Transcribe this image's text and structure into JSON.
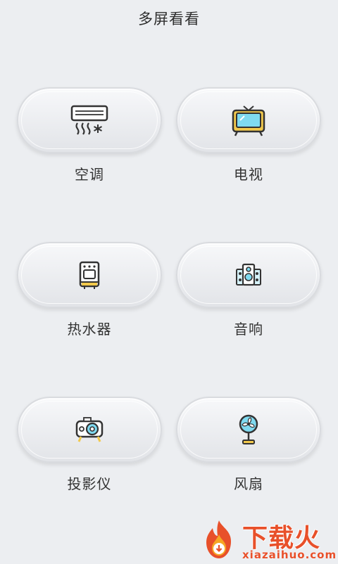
{
  "header": {
    "title": "多屏看看"
  },
  "devices": [
    {
      "label": "空调",
      "icon": "air-conditioner-icon"
    },
    {
      "label": "电视",
      "icon": "television-icon"
    },
    {
      "label": "热水器",
      "icon": "water-heater-icon"
    },
    {
      "label": "音响",
      "icon": "speaker-icon"
    },
    {
      "label": "投影仪",
      "icon": "projector-icon"
    },
    {
      "label": "风扇",
      "icon": "fan-icon"
    }
  ],
  "watermark": {
    "name": "下载火",
    "domain": "xiazaihuo.com"
  },
  "colors": {
    "background": "#eceef1",
    "icon_stroke": "#333333",
    "accent_cyan": "#7fdaf0",
    "accent_yellow": "#f2c94c",
    "watermark_orange": "#e8502a"
  }
}
